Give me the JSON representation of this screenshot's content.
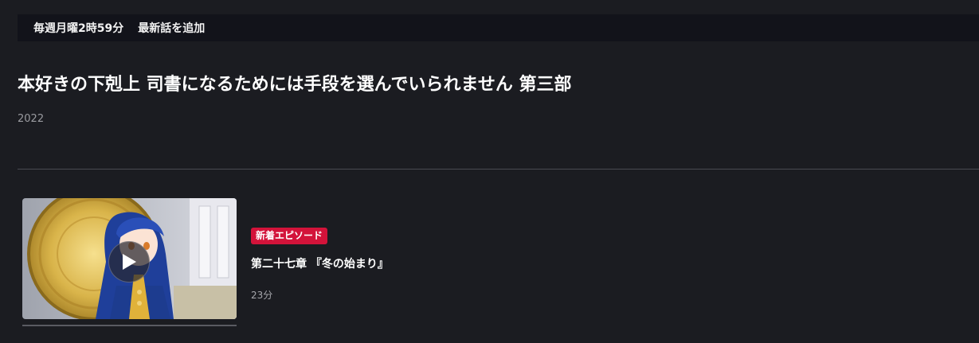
{
  "schedule": {
    "day_time": "毎週月曜2時59分",
    "note": "最新話を追加"
  },
  "series": {
    "title": "本好きの下剋上 司書になるためには手段を選んでいられません 第三部",
    "year": "2022"
  },
  "episode": {
    "badge": "新着エピソード",
    "title": "第二十七章 『冬の始まり』",
    "duration": "23分",
    "thumbnail_icon": "play-icon"
  },
  "colors": {
    "background": "#1b1c21",
    "schedule_bar": "#12131a",
    "badge": "#d3133a",
    "muted_text": "#9a9ba0"
  }
}
